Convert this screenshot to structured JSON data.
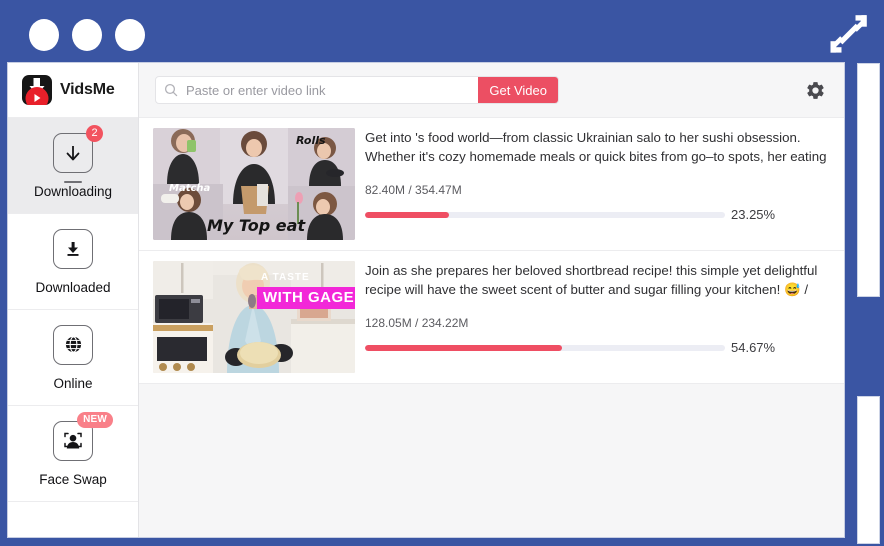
{
  "window": {
    "titlebar_color": "#3a55a3",
    "accent_color": "#ec4f63",
    "expand_icon": "expand-arrows-icon",
    "controls": [
      "window-dot-1",
      "window-dot-2",
      "window-dot-3"
    ]
  },
  "brand": {
    "name": "VidsMe",
    "logo_icon": "vidsme-download-play-logo"
  },
  "sidebar": {
    "items": [
      {
        "id": "downloading",
        "label": "Downloading",
        "icon": "download-arrow-icon",
        "badge": "2",
        "badge_type": "count",
        "badge_color": "#f2535f",
        "active": true
      },
      {
        "id": "downloaded",
        "label": "Downloaded",
        "icon": "download-tray-icon",
        "badge": "",
        "badge_type": "none",
        "active": false
      },
      {
        "id": "online",
        "label": "Online",
        "icon": "globe-icon",
        "badge": "",
        "badge_type": "none",
        "active": false
      },
      {
        "id": "face-swap",
        "label": "Face Swap",
        "icon": "face-swap-icon",
        "badge": "NEW",
        "badge_type": "new",
        "badge_color": "#f98089",
        "active": false
      }
    ]
  },
  "toolbar": {
    "search_placeholder": "Paste or enter video link",
    "search_value": "",
    "search_icon": "search-icon",
    "get_video_label": "Get Video",
    "settings_icon": "gear-icon"
  },
  "downloads": [
    {
      "title": "Get into 's food world—from classic Ukrainian salo to her sushi obsession. Whether it's cozy homemade meals or quick bites from go–to spots, her eating habits are …",
      "downloaded": "82.40M",
      "total": "354.47M",
      "size_text": "82.40M / 354.47M",
      "percent_text": "23.25%",
      "percent_value": 23.25,
      "thumbnail": {
        "type": "photo-collage",
        "overlay_texts": [
          "Matcha",
          "Rolls",
          "My Top eat"
        ]
      }
    },
    {
      "title": "Join as she prepares her beloved shortbread recipe! this simple yet delightful recipe will have the sweet scent of butter and sugar filling your kitchen! 😅 /",
      "downloaded": "128.05M",
      "total": "234.22M",
      "size_text": "128.05M / 234.22M",
      "percent_text": "54.67%",
      "percent_value": 54.67,
      "thumbnail": {
        "type": "photo",
        "overlay_texts": [
          "A TASTE",
          "WITH GAGE"
        ]
      }
    }
  ],
  "scrollbar": {
    "track_color": "#3a55a3",
    "thumb_color": "#ffffff"
  }
}
